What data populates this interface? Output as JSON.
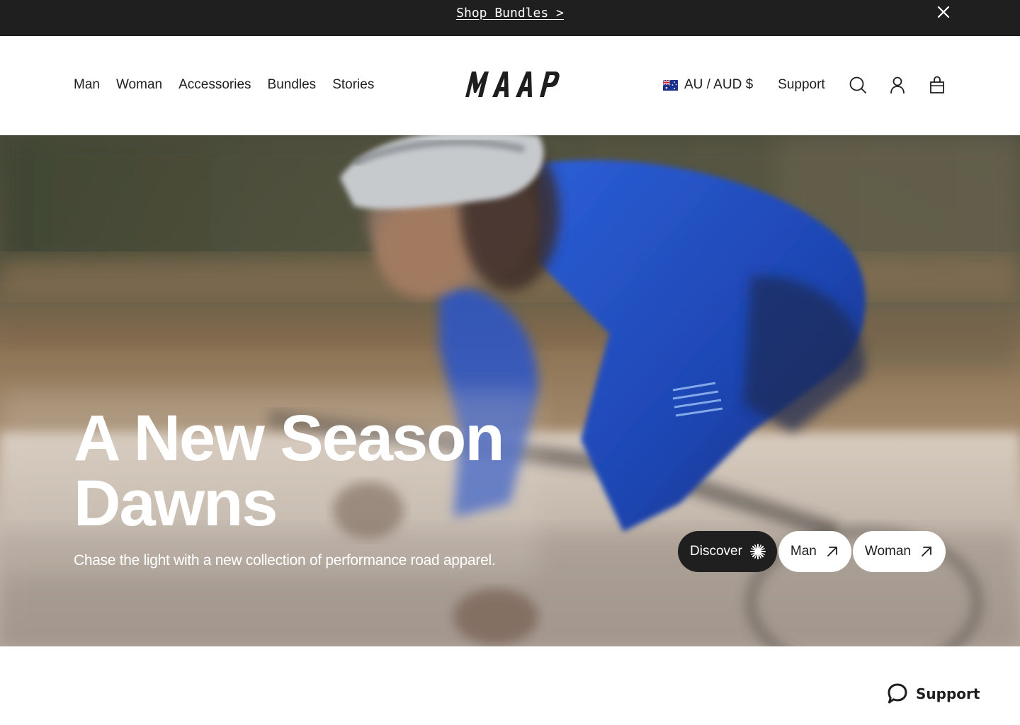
{
  "announcement": {
    "link_label": "Shop Bundles >",
    "close_icon": "close-icon"
  },
  "header": {
    "logo_text": "MAAP",
    "nav": [
      {
        "label": "Man"
      },
      {
        "label": "Woman"
      },
      {
        "label": "Accessories"
      },
      {
        "label": "Bundles"
      },
      {
        "label": "Stories"
      }
    ],
    "locale": {
      "flag_icon": "australia-flag-icon",
      "label": "AU / AUD $"
    },
    "support_label": "Support",
    "icons": [
      "search-icon",
      "account-icon",
      "cart-bag-icon"
    ]
  },
  "hero": {
    "title_line1": "A New Season",
    "title_line2": "Dawns",
    "subtitle": "Chase the light with a new collection of performance road apparel.",
    "ctas": [
      {
        "label": "Discover",
        "icon": "sparkle-icon",
        "style": "dark"
      },
      {
        "label": "Man",
        "icon": "arrow-up-right-icon",
        "style": "light"
      },
      {
        "label": "Woman",
        "icon": "arrow-up-right-icon",
        "style": "light"
      }
    ]
  },
  "support_widget": {
    "label": "Support",
    "icon": "chat-bubble-icon"
  },
  "colors": {
    "announcement_bg": "#1f1f1f",
    "text": "#1e1e1e",
    "jersey_blue": "#1f4fc4",
    "cta_dark": "#1f1f1f",
    "cta_light": "#ffffff"
  }
}
